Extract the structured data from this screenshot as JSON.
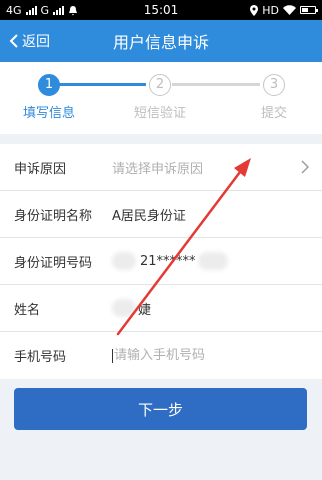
{
  "status_bar": {
    "left": "4G",
    "left2": "G",
    "time": "15:01",
    "right": "HD"
  },
  "nav": {
    "back_label": "返回",
    "title": "用户信息申诉"
  },
  "steps": [
    {
      "number": "1",
      "label": "填写信息"
    },
    {
      "number": "2",
      "label": "短信验证"
    },
    {
      "number": "3",
      "label": "提交"
    }
  ],
  "form": {
    "reason": {
      "label": "申诉原因",
      "placeholder": "请选择申诉原因"
    },
    "id_type": {
      "label": "身份证明名称",
      "value": "A居民身份证"
    },
    "id_number": {
      "label": "身份证明号码",
      "value": "21******"
    },
    "name": {
      "label": "姓名",
      "value": "婕"
    },
    "phone": {
      "label": "手机号码",
      "placeholder": "请输入手机号码"
    }
  },
  "next_button": "下一步",
  "colors": {
    "primary": "#2f8bdb",
    "button": "#2f6cc4",
    "annotation": "#e53935"
  }
}
